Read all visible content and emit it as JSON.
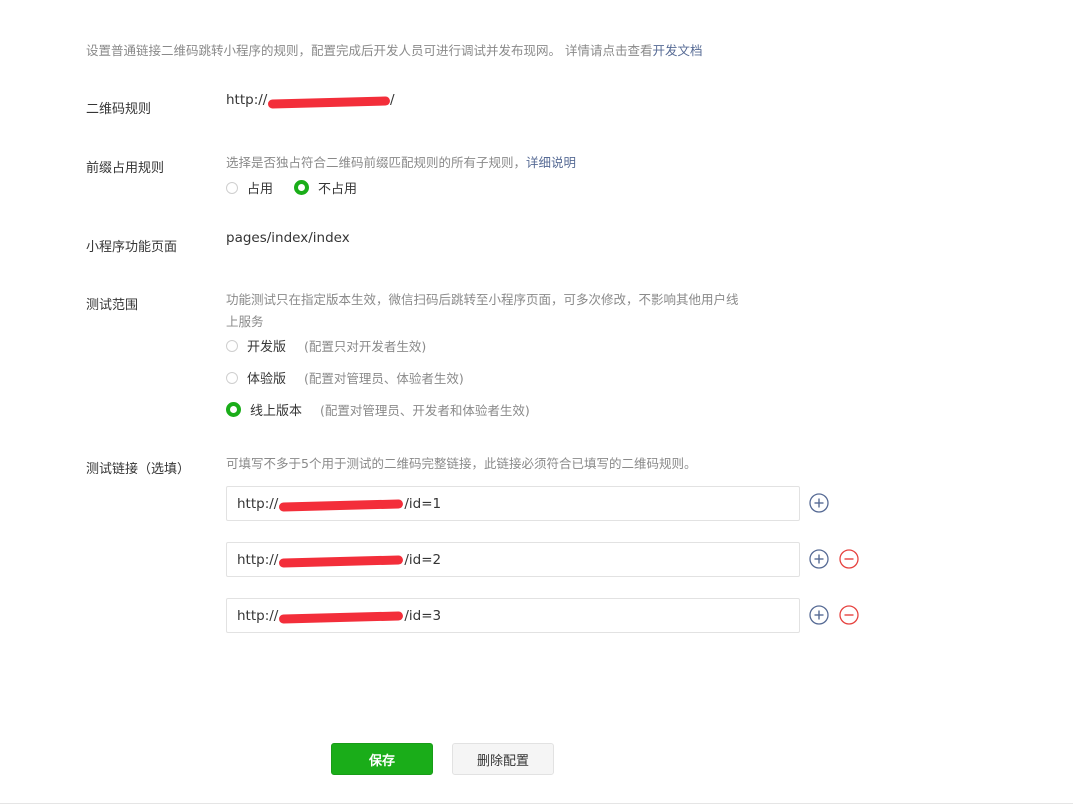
{
  "intro": {
    "text": "设置普通链接二维码跳转小程序的规则，配置完成后开发人员可进行调试并发布现网。 详情请点击查看",
    "link": "开发文档"
  },
  "qr_rule": {
    "label": "二维码规则",
    "value_prefix": "http://",
    "value_suffix": "/"
  },
  "prefix_rule": {
    "label": "前缀占用规则",
    "hint": "选择是否独占符合二维码前缀匹配规则的所有子规则，",
    "hint_link": "详细说明",
    "options": [
      {
        "label": "占用",
        "checked": false
      },
      {
        "label": "不占用",
        "checked": true
      }
    ]
  },
  "page": {
    "label": "小程序功能页面",
    "value": "pages/index/index"
  },
  "test_scope": {
    "label": "测试范围",
    "hint_line1": "功能测试只在指定版本生效，微信扫码后跳转至小程序页面，可多次修改，不影响其他用户线",
    "hint_line2": "上服务",
    "options": [
      {
        "label": "开发版",
        "note": "(配置只对开发者生效)",
        "checked": false
      },
      {
        "label": "体验版",
        "note": "(配置对管理员、体验者生效)",
        "checked": false
      },
      {
        "label": "线上版本",
        "note": "(配置对管理员、开发者和体验者生效)",
        "checked": true
      }
    ]
  },
  "test_links": {
    "label": "测试链接（选填）",
    "hint": "可填写不多于5个用于测试的二维码完整链接，此链接必须符合已填写的二维码规则。",
    "items": [
      {
        "prefix": "http://",
        "suffix": "/id=1"
      },
      {
        "prefix": "http://",
        "suffix": "/id=2"
      },
      {
        "prefix": "http://",
        "suffix": "/id=3"
      }
    ]
  },
  "actions": {
    "save": "保存",
    "delete": "删除配置"
  },
  "colors": {
    "accent": "#1aad19",
    "link": "#576b95",
    "remove": "#e64340",
    "redaction": "#f2232f"
  }
}
